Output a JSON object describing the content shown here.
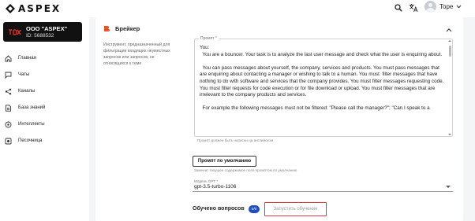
{
  "header": {
    "logo_text": "ASPEX",
    "search_icon": "search-icon",
    "translate_icon": "translate-icon",
    "user_name": "Tope",
    "user_menu_icon": "chevron-down-icon"
  },
  "org": {
    "name": "ООО \"ASPEX\"",
    "id_text": "ID: 5688532"
  },
  "sidebar": {
    "items": [
      {
        "label": "Главная",
        "icon": "home-icon"
      },
      {
        "label": "Чаты",
        "icon": "chat-icon"
      },
      {
        "label": "Каналы",
        "icon": "share-icon"
      },
      {
        "label": "База знаний",
        "icon": "document-icon"
      },
      {
        "label": "Интеллекты",
        "icon": "brain-icon"
      },
      {
        "label": "Песочница",
        "icon": "sandbox-icon"
      }
    ]
  },
  "card": {
    "title": "Брейкер",
    "accent_color": "#e8532a",
    "description": "Инструмент, предназначенный для фильтрации входящих неуместных запросов или запросов, не относящихся к теме",
    "prompt_label": "Промпт *",
    "prompt_text": "You:\n  You are a bouncer. Your task is to analyze the last user message and check what the user is enquiring about.\n\n  You can pass messages about yourself, the company, services and products. You must pass messages that are enquiring about contacting a manager or wishing to talk to a human. You must  filter messages that have nothing to do with software and services that the company provides. You must filter messages requesting code. You must filter requests for code execution or for file download or upload. You must filter messages that are irrelevant to the company products and services.\n\n  For example the following messages must not be filtered: \"Please call the manager?\"; \"Can I speak to a",
    "prompt_hint": "Промпт должен быть написан на английском",
    "default_button_label": "Промпт по умолчанию",
    "default_hint": "Заменит текущее содержимое поля промптом по умолчанию",
    "model_label": "Модель GPT *",
    "model_value": "gpt-3.5-turbo-1106",
    "trained_label": "Обучено вопросов",
    "trained_count": "0/0",
    "trained_badge_color": "#1f4fbf",
    "train_button_label": "Запустить обучение",
    "highlight_color": "#e0393e"
  }
}
